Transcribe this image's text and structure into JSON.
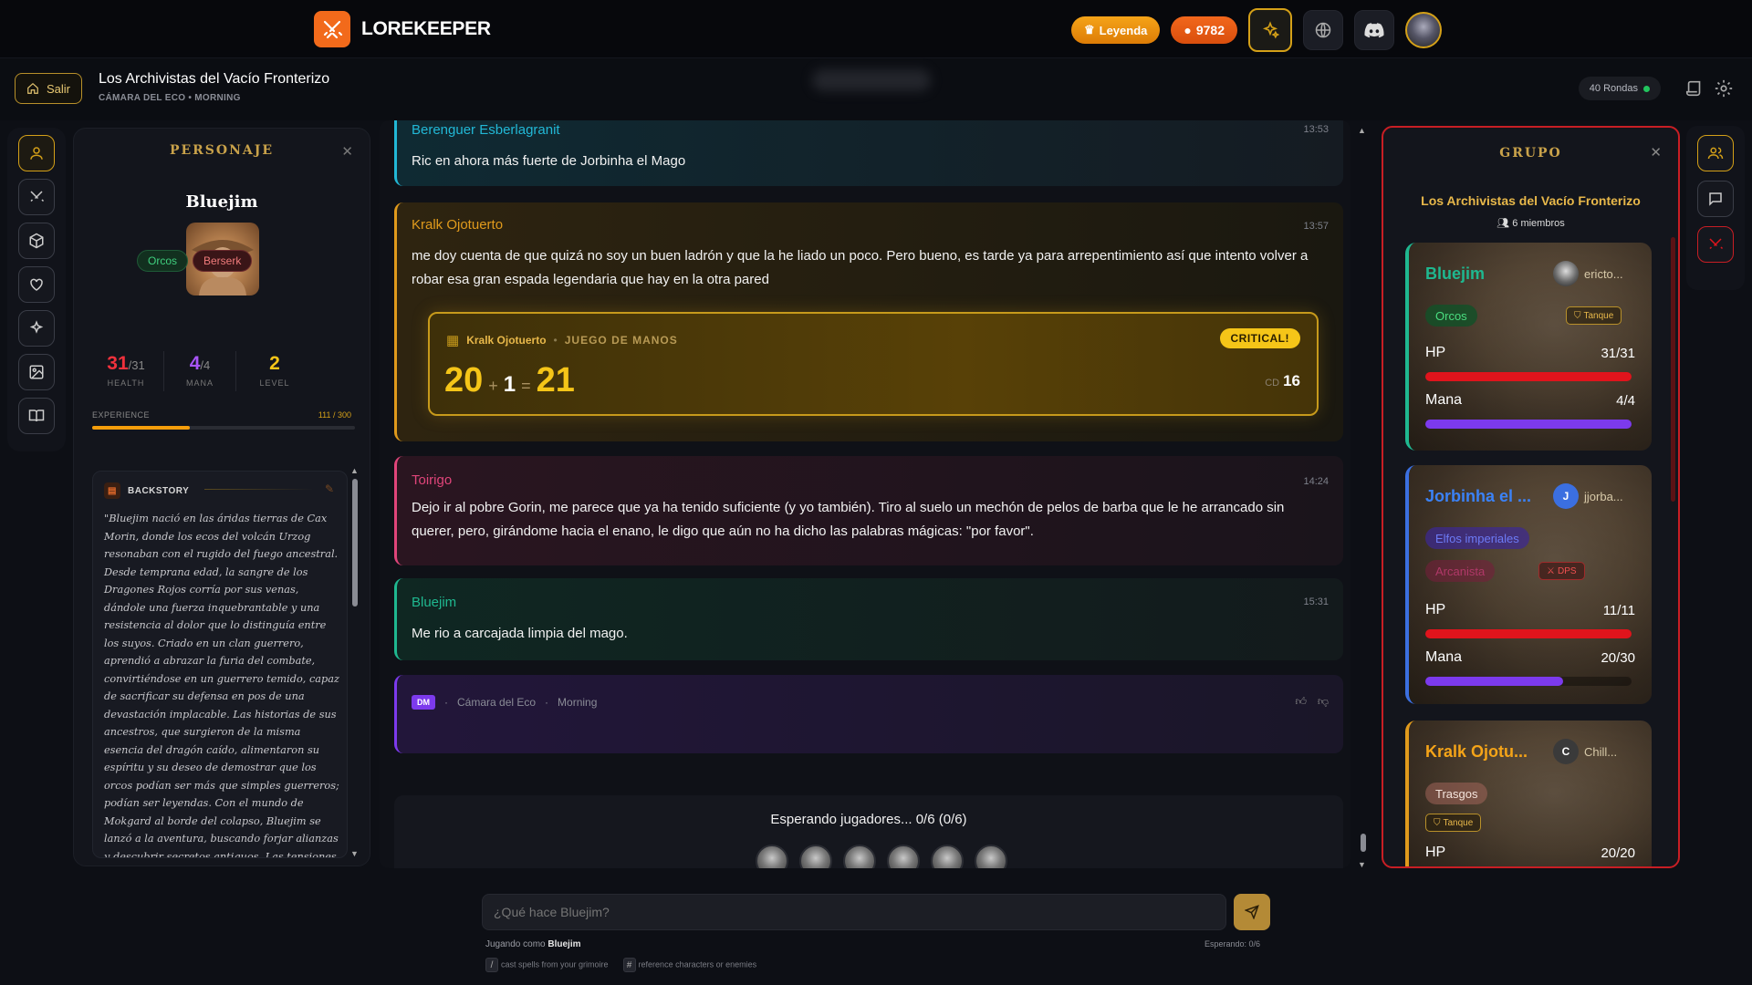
{
  "topbar": {
    "brand": "LOREKEEPER",
    "tier_badge": "Leyenda",
    "coins": "9782"
  },
  "subbar": {
    "exit_label": "Salir",
    "campaign_title": "Los Archivistas del Vacío Fronterizo",
    "campaign_subtitle": "CÁMARA DEL ECO • MORNING",
    "rounds": "40 Rondas"
  },
  "character": {
    "panel_title": "PERSONAJE",
    "name": "Bluejim",
    "race": "Orcos",
    "class": "Berserk",
    "health_current": "31",
    "health_max": "/31",
    "health_label": "HEALTH",
    "mana_current": "4",
    "mana_max": "/4",
    "mana_label": "MANA",
    "level": "2",
    "level_label": "LEVEL",
    "experience_label": "EXPERIENCE",
    "experience_value": "111 / 300",
    "experience_fraction": 0.37,
    "backstory_title": "BACKSTORY",
    "backstory": "\"Bluejim nació en las áridas tierras de Cax Morin, donde los ecos del volcán Urzog resonaban con el rugido del fuego ancestral. Desde temprana edad, la sangre de los Dragones Rojos corría por sus venas, dándole una fuerza inquebrantable y una resistencia al dolor que lo distinguía entre los suyos. Criado en un clan guerrero, aprendió a abrazar la furia del combate, convirtiéndose en un guerrero temido, capaz de sacrificar su defensa en pos de una devastación implacable. Las historias de sus ancestros, que surgieron de la misma esencia del dragón caído, alimentaron su espíritu y su deseo de demostrar que los orcos podían ser más que simples guerreros; podían ser leyendas. Con el mundo de Mokgard al borde del colapso, Bluejim se lanzó a la aventura, buscando forjar alianzas y descubrir secretos antiguos. Las tensiones entre las ciudades-estado de Balrol u"
  },
  "feed": {
    "messages": [
      {
        "author": "Berenguer Esberlagranit",
        "time": "13:53",
        "text": "Ric en ahora más fuerte de Jorbinha el Mago",
        "color": "#22b8d6"
      },
      {
        "author": "Kralk Ojotuerto",
        "time": "13:57",
        "text": "me doy cuenta de que quizá no soy un buen ladrón y que la he liado un poco. Pero bueno, es tarde ya para arrepentimiento así que intento volver a robar esa gran espada legendaria que hay en la otra pared",
        "color": "#e09a1c"
      },
      {
        "author": "Toirigo",
        "time": "14:24",
        "text": "Dejo ir al pobre Gorin, me parece que ya ha tenido suficiente (y yo también). Tiro al suelo un mechón de pelos de barba que le he arrancado sin querer, pero, girándome hacia el enano, le digo que aún no ha dicho las palabras mágicas: \"por favor\".",
        "color": "#e0457a"
      },
      {
        "author": "Bluejim",
        "time": "15:31",
        "text": "Me rio a carcajada limpia del mago.",
        "color": "#1fb890"
      }
    ],
    "roll": {
      "character": "Kralk Ojotuerto",
      "skill": "JUEGO DE MANOS",
      "result_badge": "CRITICAL!",
      "die": "20",
      "plus": "+",
      "modifier": "1",
      "equals": "=",
      "total": "21",
      "cd_label": "CD",
      "cd_value": "16"
    },
    "dm": {
      "badge": "DM",
      "location": "Cámara del Eco",
      "time_of_day": "Morning"
    },
    "waiting_text": "Esperando jugadores... 0/6 (0/6)"
  },
  "group": {
    "panel_title": "GRUPO",
    "campaign": "Los Archivistas del Vacío Fronterizo",
    "members_count": "6 miembros",
    "members": [
      {
        "name": "Bluejim",
        "user": "ericto...",
        "avatar_letter": "",
        "race": "Orcos",
        "role": "Tanque",
        "hp_label": "HP",
        "hp": "31/31",
        "hp_fraction": 1.0,
        "mana_label": "Mana",
        "mana": "4/4",
        "mana_fraction": 1.0,
        "accent": "#1fb890"
      },
      {
        "name": "Jorbinha el ...",
        "user": "jjorba...",
        "avatar_letter": "J",
        "race": "Elfos imperiales",
        "class": "Arcanista",
        "role": "DPS",
        "hp_label": "HP",
        "hp": "11/11",
        "hp_fraction": 1.0,
        "mana_label": "Mana",
        "mana": "20/30",
        "mana_fraction": 0.67,
        "accent": "#3b6fe0"
      },
      {
        "name": "Kralk Ojotu...",
        "user": "Chill...",
        "avatar_letter": "C",
        "race": "Trasgos",
        "role": "Tanque",
        "hp_label": "HP",
        "hp": "20/20",
        "accent": "#e09a1c"
      }
    ]
  },
  "composer": {
    "placeholder": "¿Qué hace Bluejim?",
    "playing_as_prefix": "Jugando como",
    "playing_as_name": "Bluejim",
    "waiting": "Esperando: 0/6",
    "hint_slash_key": "/",
    "hint_slash": "cast spells from your grimoire",
    "hint_hash_key": "#",
    "hint_hash": "reference characters or enemies"
  }
}
